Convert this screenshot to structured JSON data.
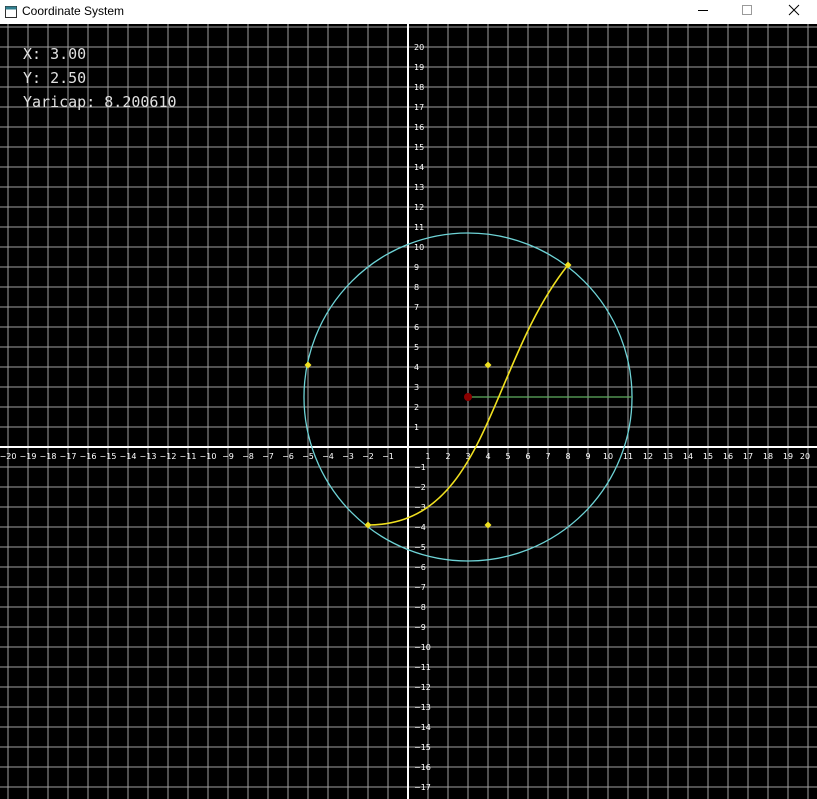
{
  "window": {
    "title": "Coordinate System",
    "icon": "app-window-icon",
    "controls": {
      "minimize_icon": "minimize-icon",
      "maximize_icon": "maximize-icon",
      "close_icon": "close-icon"
    }
  },
  "readout": {
    "x_label": "X:",
    "x_value": "3.00",
    "y_label": "Y:",
    "y_value": "2.50",
    "extra_label": "Yaricap:",
    "extra_value": "8.200610"
  },
  "colors": {
    "background": "#000000",
    "grid": "#a0a0a0",
    "axis": "#ffffff",
    "circle": "#6ed3d6",
    "curve": "#f0e020",
    "control_point": "#f0e020",
    "center_point": "#8b0000",
    "radius_line": "#5fae5f",
    "tick_text": "#ffffff"
  },
  "plot": {
    "x_range": [
      -20,
      20
    ],
    "y_range": [
      -18,
      20
    ],
    "circle": {
      "center": [
        3,
        2.5
      ],
      "radius": 8.20061
    },
    "center_point": [
      3,
      2.5
    ],
    "radius_line": {
      "from": [
        3,
        2.5
      ],
      "to": [
        11.2,
        2.5
      ]
    },
    "curve_points": [
      [
        8,
        9.1
      ],
      [
        4,
        4.1
      ],
      [
        4,
        -3.9
      ],
      [
        -2,
        -3.9
      ]
    ],
    "control_points": [
      [
        -5,
        4.1
      ],
      [
        8,
        9.1
      ],
      [
        4,
        4.1
      ],
      [
        4,
        -3.9
      ],
      [
        -2,
        -3.9
      ]
    ]
  }
}
